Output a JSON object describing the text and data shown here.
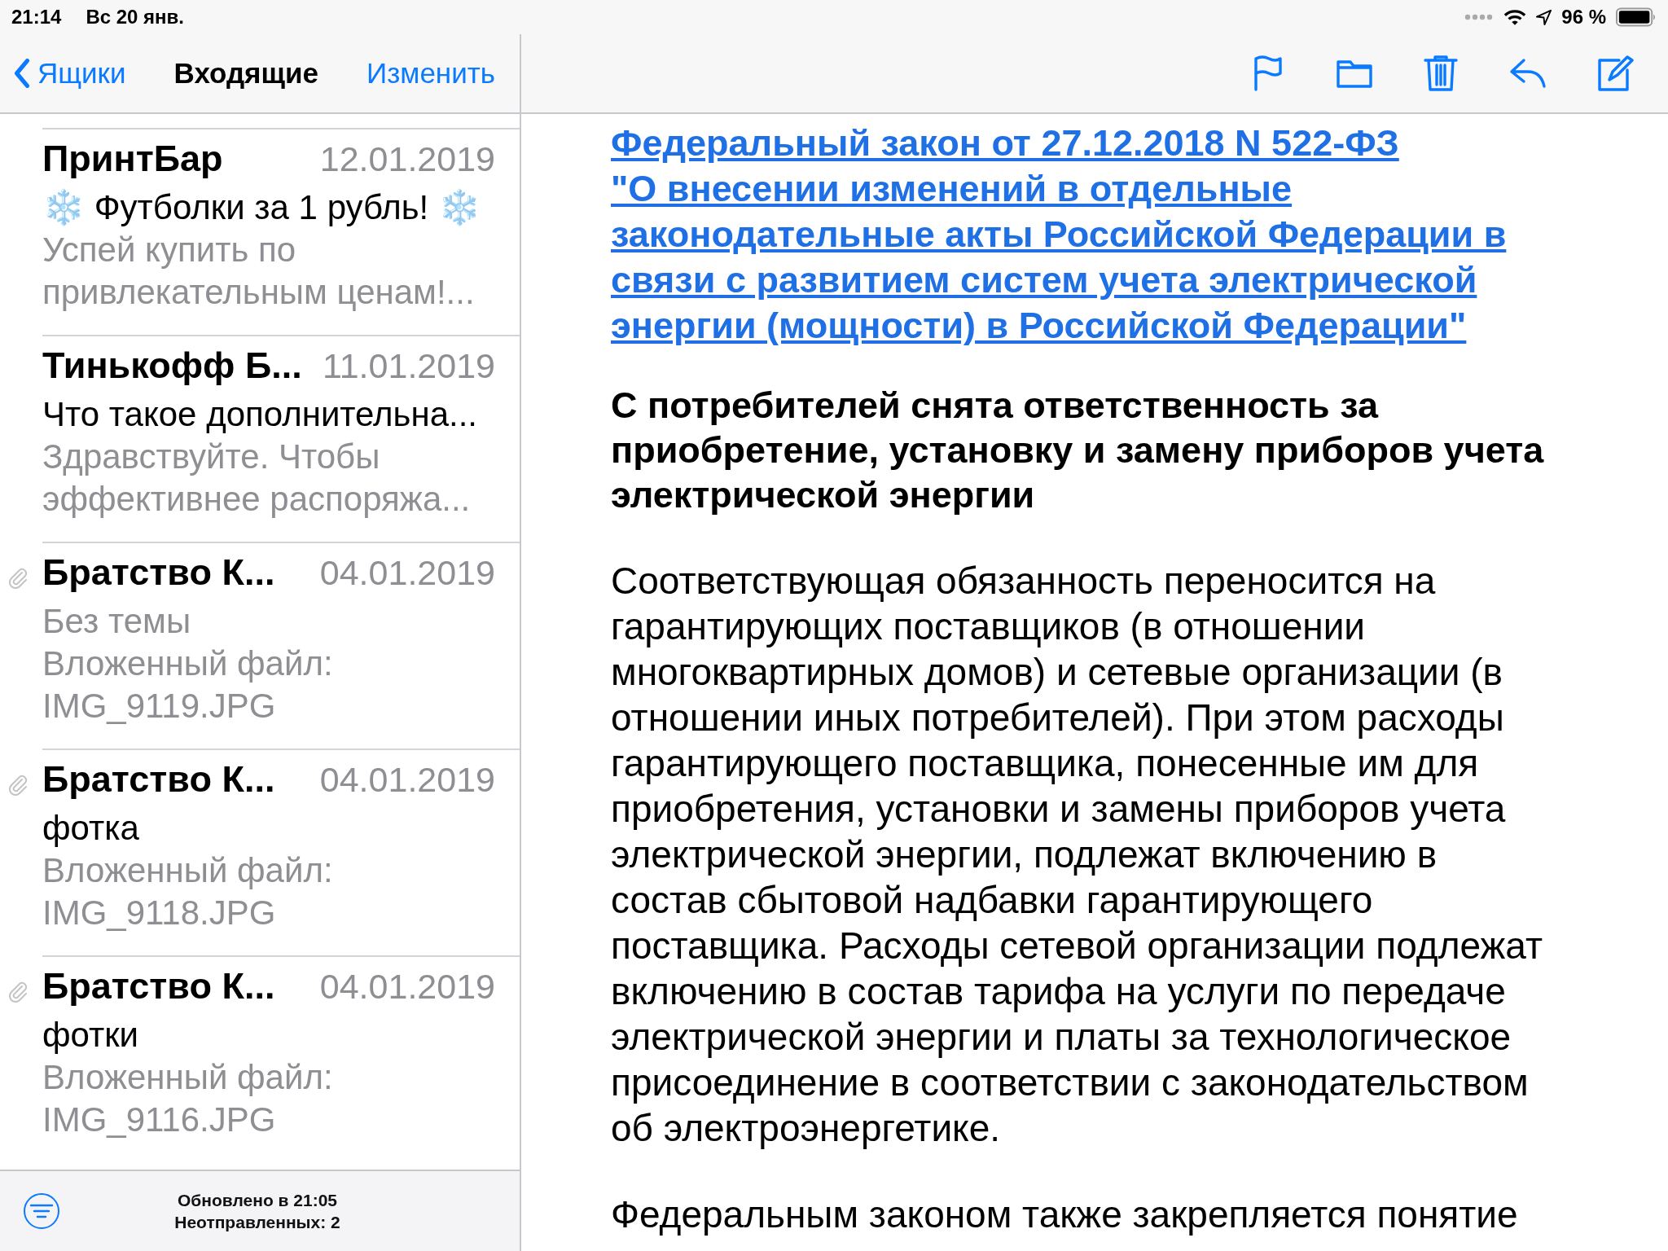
{
  "status_bar": {
    "time": "21:14",
    "date": "Вс 20 янв.",
    "battery": "96 %"
  },
  "mailbox_nav": {
    "back": "Ящики",
    "title": "Входящие",
    "edit": "Изменить"
  },
  "messages": [
    {
      "sender": "ПринтБар",
      "date": "12.01.2019",
      "attachment": false,
      "subject": "❄️ Футболки за 1 рубль! ❄️",
      "empty_subject": false,
      "preview": [
        "Успей купить по",
        "привлекательным ценам!..."
      ]
    },
    {
      "sender": "Тинькофф Б...",
      "date": "11.01.2019",
      "attachment": false,
      "subject": "Что такое дополнительна...",
      "empty_subject": false,
      "preview": [
        "Здравствуйте. Чтобы",
        "эффективнее распоряжа..."
      ]
    },
    {
      "sender": "Братство К...",
      "date": "04.01.2019",
      "attachment": true,
      "subject": "Без темы",
      "empty_subject": true,
      "preview": [
        "Вложенный файл:",
        "IMG_9119.JPG"
      ]
    },
    {
      "sender": "Братство К...",
      "date": "04.01.2019",
      "attachment": true,
      "subject": "фотка",
      "empty_subject": false,
      "preview": [
        "Вложенный файл:",
        "IMG_9118.JPG"
      ]
    },
    {
      "sender": "Братство К...",
      "date": "04.01.2019",
      "attachment": true,
      "subject": "фотки",
      "empty_subject": false,
      "preview": [
        "Вложенный файл:",
        "IMG_9116.JPG"
      ]
    }
  ],
  "footer": {
    "lines": [
      "Обновлено в 21:05",
      "Неотправленных: 2"
    ]
  },
  "message": {
    "link_lines": [
      "Федеральный закон от 27.12.2018 N 522-ФЗ",
      "\"О внесении изменений в отдельные",
      "законодательные акты Российской Федерации в",
      "связи с развитием систем учета электрической",
      "энергии (мощности) в Российской Федерации\""
    ],
    "heading_lines": [
      "С потребителей снята ответственность за",
      "приобретение, установку и замену приборов учета",
      "электрической энергии"
    ],
    "paragraphs": [
      [
        "Соответствующая обязанность переносится на",
        "гарантирующих поставщиков (в отношении",
        "многоквартирных домов) и сетевые организации (в",
        "отношении иных потребителей). При этом расходы",
        "гарантирующего поставщика, понесенные им для",
        "приобретения, установки и замены приборов учета",
        "электрической энергии, подлежат включению в",
        "состав сбытовой надбавки гарантирующего",
        "поставщика. Расходы сетевой организации подлежат",
        "включению в состав тарифа на услуги по передаче",
        "электрической энергии и платы за технологическое",
        "присоединение в соответствии с законодательством",
        "об электроэнергетике."
      ],
      [
        "Федеральным законом также закрепляется понятие"
      ]
    ]
  }
}
